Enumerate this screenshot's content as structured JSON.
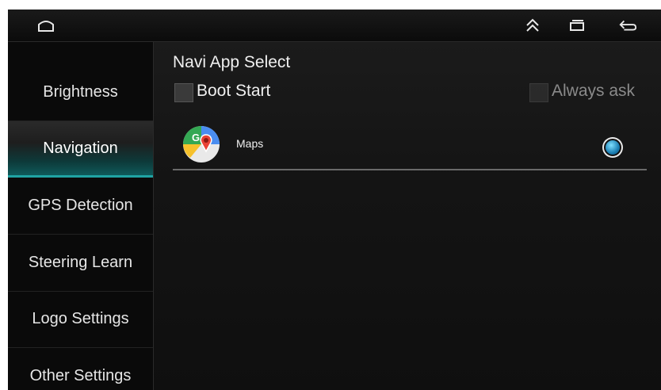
{
  "topbar": {
    "home_icon": "home-icon",
    "up_icon": "double-chevron-up-icon",
    "recents_icon": "recents-icon",
    "back_icon": "back-icon"
  },
  "sidebar": {
    "items": [
      {
        "label": "Brightness",
        "active": false
      },
      {
        "label": "Navigation",
        "active": true
      },
      {
        "label": "GPS Detection",
        "active": false
      },
      {
        "label": "Steering Learn",
        "active": false
      },
      {
        "label": "Logo Settings",
        "active": false
      },
      {
        "label": "Other Settings",
        "active": false
      }
    ]
  },
  "main": {
    "title": "Navi App Select",
    "boot_start": {
      "label": "Boot Start",
      "checked": false
    },
    "always_ask": {
      "label": "Always ask",
      "checked": false,
      "disabled": true
    },
    "apps": [
      {
        "name": "Maps",
        "selected": true,
        "icon": "google-maps-icon"
      }
    ]
  },
  "colors": {
    "accent": "#1fa3a3",
    "background": "#0d0d0d",
    "text": "#e6e6e6"
  }
}
